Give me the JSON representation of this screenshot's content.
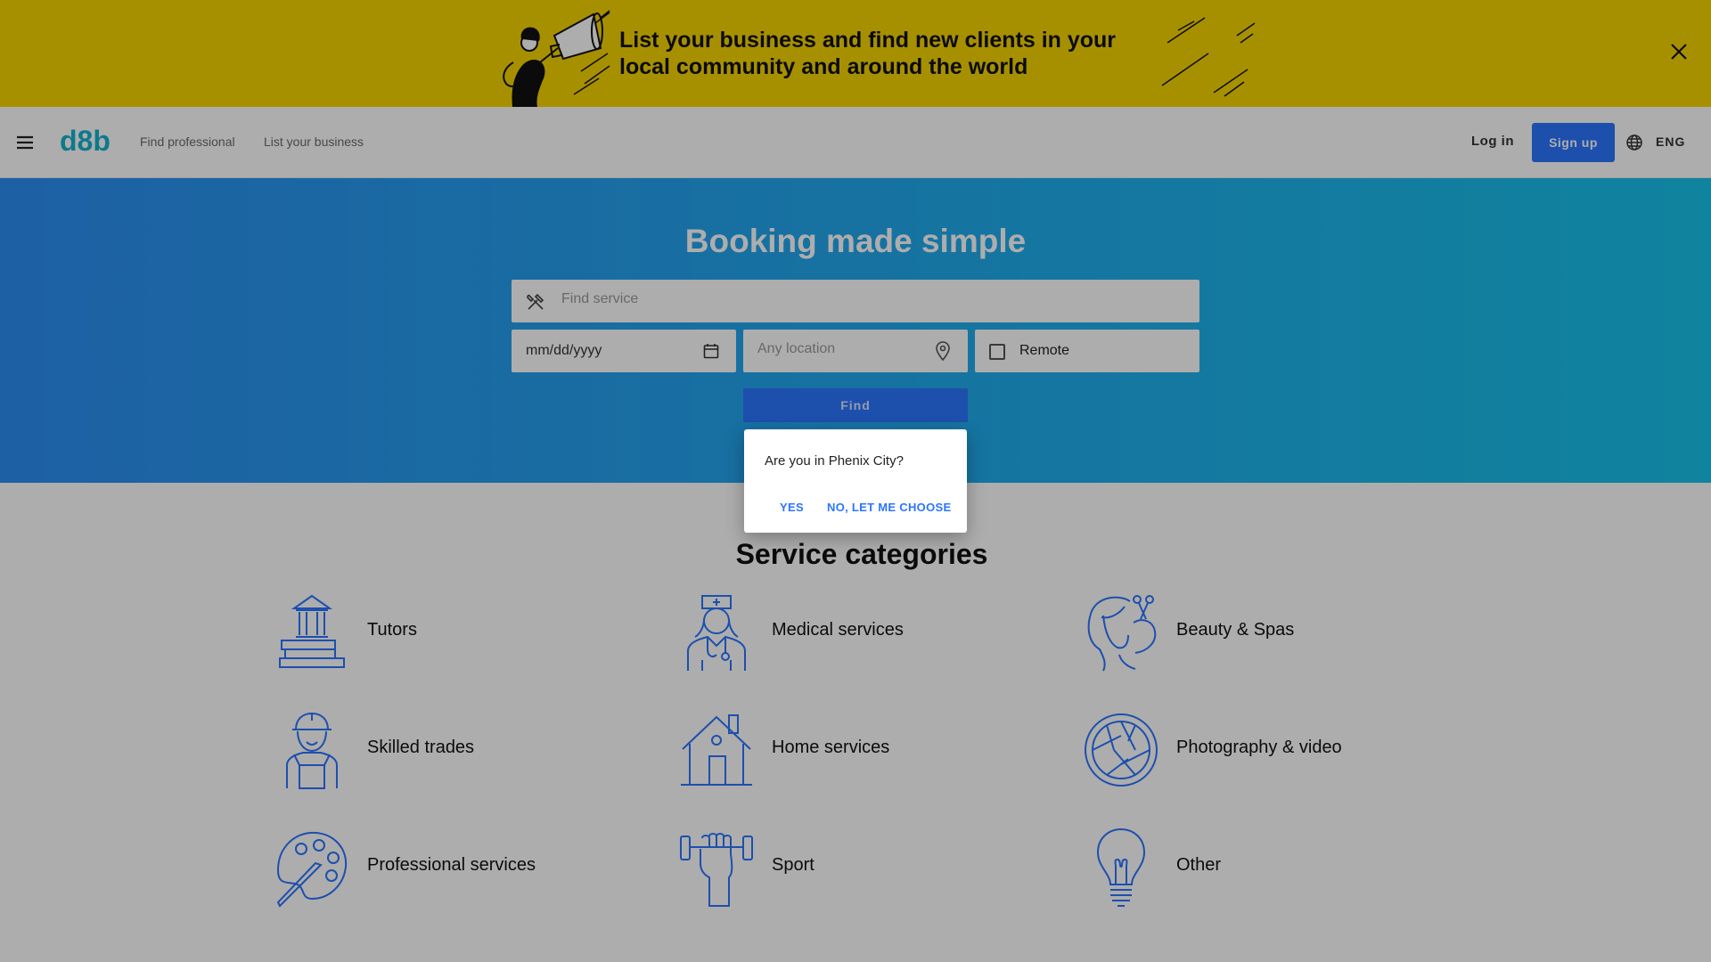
{
  "banner": {
    "text": "List your business and find new clients in your local community and around the world",
    "close_icon": "close-icon",
    "illustration_icon": "megaphone-woman-illustration",
    "background": "#f7d400"
  },
  "header": {
    "logo": "d8b",
    "nav": [
      "Find professional",
      "List your business"
    ],
    "login_label": "Log in",
    "signup_label": "Sign up",
    "language": "ENG",
    "accent_color": "#2c75ff",
    "logo_color": "#16b3ce"
  },
  "hero": {
    "title": "Booking made simple",
    "service_placeholder": "Find service",
    "date_placeholder": "mm/dd/yyyy",
    "location_placeholder": "Any location",
    "remote_label": "Remote",
    "find_label": "Find",
    "gradient": [
      "#2c8ff2",
      "#18c2ea"
    ]
  },
  "categories": {
    "title": "Service categories",
    "items": [
      {
        "label": "Tutors",
        "icon": "school-books-icon"
      },
      {
        "label": "Medical services",
        "icon": "nurse-icon"
      },
      {
        "label": "Beauty & Spas",
        "icon": "beauty-hair-scissors-icon"
      },
      {
        "label": "Skilled trades",
        "icon": "construction-worker-icon"
      },
      {
        "label": "Home services",
        "icon": "house-icon"
      },
      {
        "label": "Photography & video",
        "icon": "camera-aperture-icon"
      },
      {
        "label": "Professional services",
        "icon": "palette-brush-icon"
      },
      {
        "label": "Sport",
        "icon": "dumbbell-fist-icon"
      },
      {
        "label": "Other",
        "icon": "lightbulb-icon"
      }
    ]
  },
  "dialog": {
    "question": "Are you in Phenix City?",
    "yes_label": "YES",
    "no_label": "NO, LET ME CHOOSE"
  }
}
